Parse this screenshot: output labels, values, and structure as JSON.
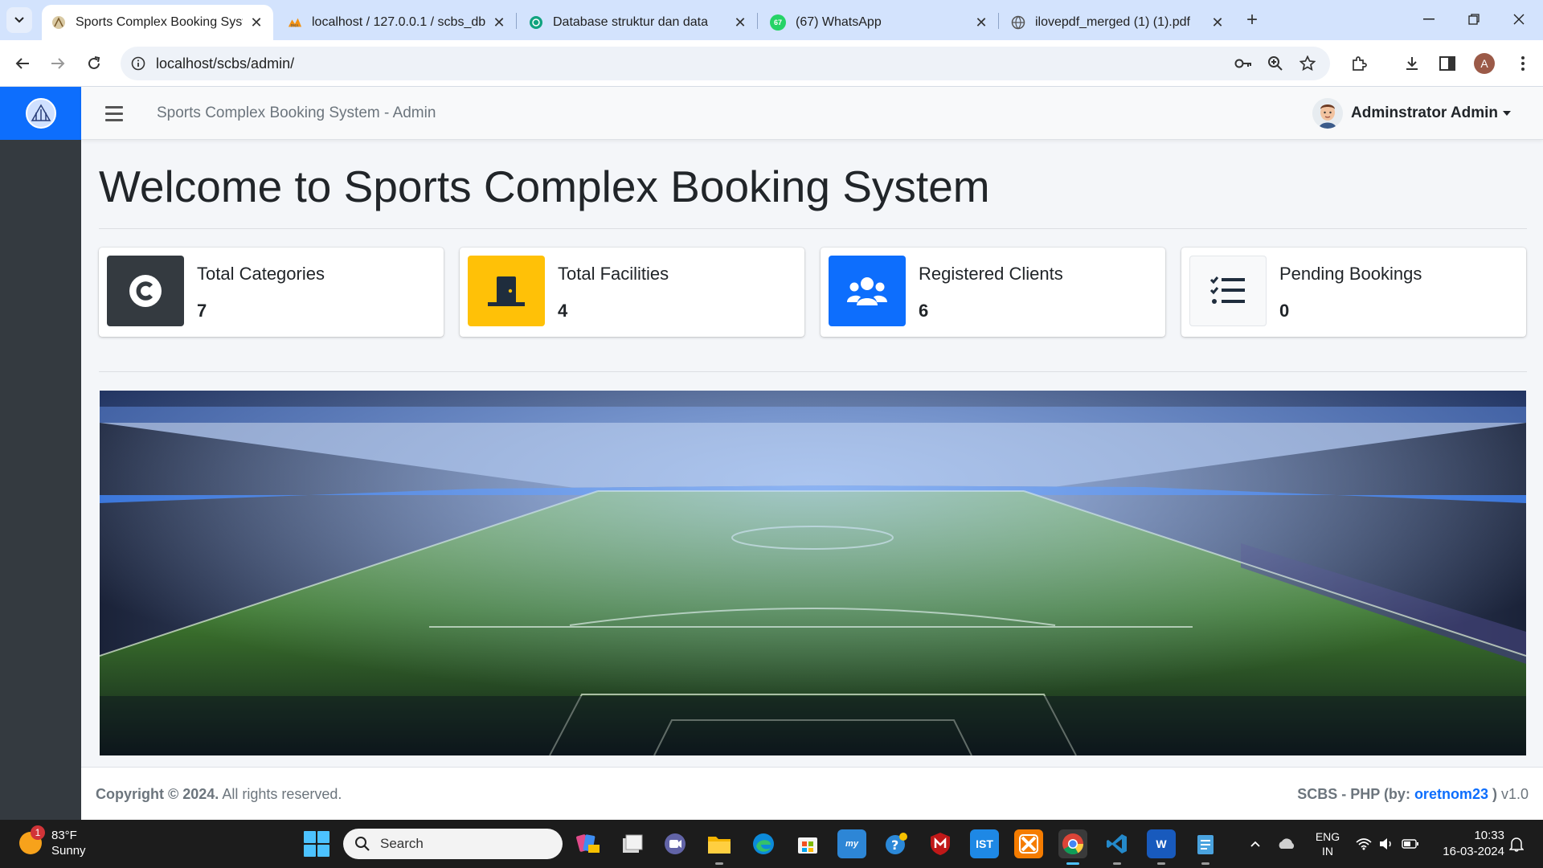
{
  "browser": {
    "tabs": [
      {
        "title": "Sports Complex Booking System",
        "active": true
      },
      {
        "title": "localhost / 127.0.0.1 / scbs_db / ",
        "active": false
      },
      {
        "title": "Database struktur dan data",
        "active": false
      },
      {
        "title": "(67) WhatsApp",
        "active": false
      },
      {
        "title": "ilovepdf_merged (1) (1).pdf",
        "active": false
      }
    ],
    "whatsapp_badge": "67",
    "url": "localhost/scbs/admin/",
    "profile_initial": "A",
    "new_tab_symbol": "+"
  },
  "app": {
    "navbar_title": "Sports Complex Booking System - Admin",
    "user_name": "Adminstrator Admin",
    "page_title": "Welcome to Sports Complex Booking System",
    "stats": [
      {
        "label": "Total Categories",
        "value": "7",
        "icon": "copyright-icon",
        "color": "#343a40"
      },
      {
        "label": "Total Facilities",
        "value": "4",
        "icon": "door-icon",
        "color": "#ffc107"
      },
      {
        "label": "Registered Clients",
        "value": "6",
        "icon": "users-icon",
        "color": "#0d6efd"
      },
      {
        "label": "Pending Bookings",
        "value": "0",
        "icon": "tasks-icon",
        "color": "#f8f9fa"
      }
    ],
    "footer": {
      "copyright": "Copyright © 2024.",
      "rights": " All rights reserved.",
      "credit_prefix": "SCBS - PHP (by: ",
      "credit_author": "oretnom23",
      "credit_suffix": " )",
      "version": " v1.0"
    },
    "colors": {
      "primary": "#0d6efd",
      "sidebar": "#343a40",
      "warning": "#ffc107"
    }
  },
  "taskbar": {
    "weather_temp": "83°F",
    "weather_desc": "Sunny",
    "weather_badge": "1",
    "search_label": "Search",
    "apps": [
      "pre-app",
      "file-manager",
      "video-call",
      "file-explorer",
      "edge",
      "store",
      "mylip",
      "helper",
      "mcafee",
      "ist",
      "xampp",
      "chrome",
      "vscode",
      "word",
      "notepad"
    ],
    "lang_top": "ENG",
    "lang_bottom": "IN",
    "time": "10:33",
    "date": "16-03-2024"
  }
}
